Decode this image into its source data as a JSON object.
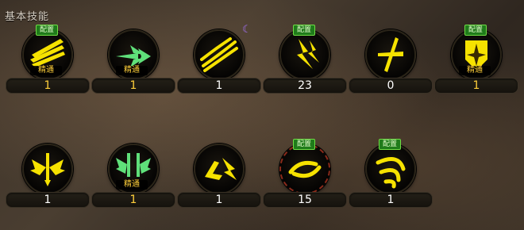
{
  "panel": {
    "title": "基本技能"
  },
  "badge_text": "配置",
  "mastery_text": "精通",
  "skills": [
    {
      "icon": "claw-slash-icon",
      "level": "1",
      "badge": true,
      "mastery": true,
      "gold": true
    },
    {
      "icon": "spear-thrust-icon",
      "level": "1",
      "badge": false,
      "mastery": true,
      "gold": true
    },
    {
      "icon": "multi-slash-icon",
      "level": "1",
      "badge": false,
      "mastery": false,
      "gold": false,
      "moon": true
    },
    {
      "icon": "lightning-strike-icon",
      "level": "23",
      "badge": true,
      "mastery": false,
      "gold": false
    },
    {
      "icon": "cross-slash-icon",
      "level": "0",
      "badge": false,
      "mastery": false,
      "gold": false
    },
    {
      "icon": "shield-burst-icon",
      "level": "1",
      "badge": true,
      "mastery": true,
      "gold": true
    },
    {
      "icon": "winged-sword-icon",
      "level": "1",
      "badge": false,
      "mastery": false,
      "gold": false
    },
    {
      "icon": "twin-wings-icon",
      "level": "1",
      "badge": false,
      "mastery": true,
      "gold": true
    },
    {
      "icon": "dash-strike-icon",
      "level": "1",
      "badge": false,
      "mastery": false,
      "gold": false
    },
    {
      "icon": "vortex-icon",
      "level": "15",
      "badge": true,
      "mastery": false,
      "gold": false,
      "dashed": true
    },
    {
      "icon": "whirlwind-icon",
      "level": "1",
      "badge": true,
      "mastery": false,
      "gold": false
    }
  ],
  "colors": {
    "icon_yellow": "#f6e200",
    "icon_green": "#5fe07a",
    "badge_green": "#1f7b1a",
    "mastery_gold": "#ffcf3a"
  }
}
